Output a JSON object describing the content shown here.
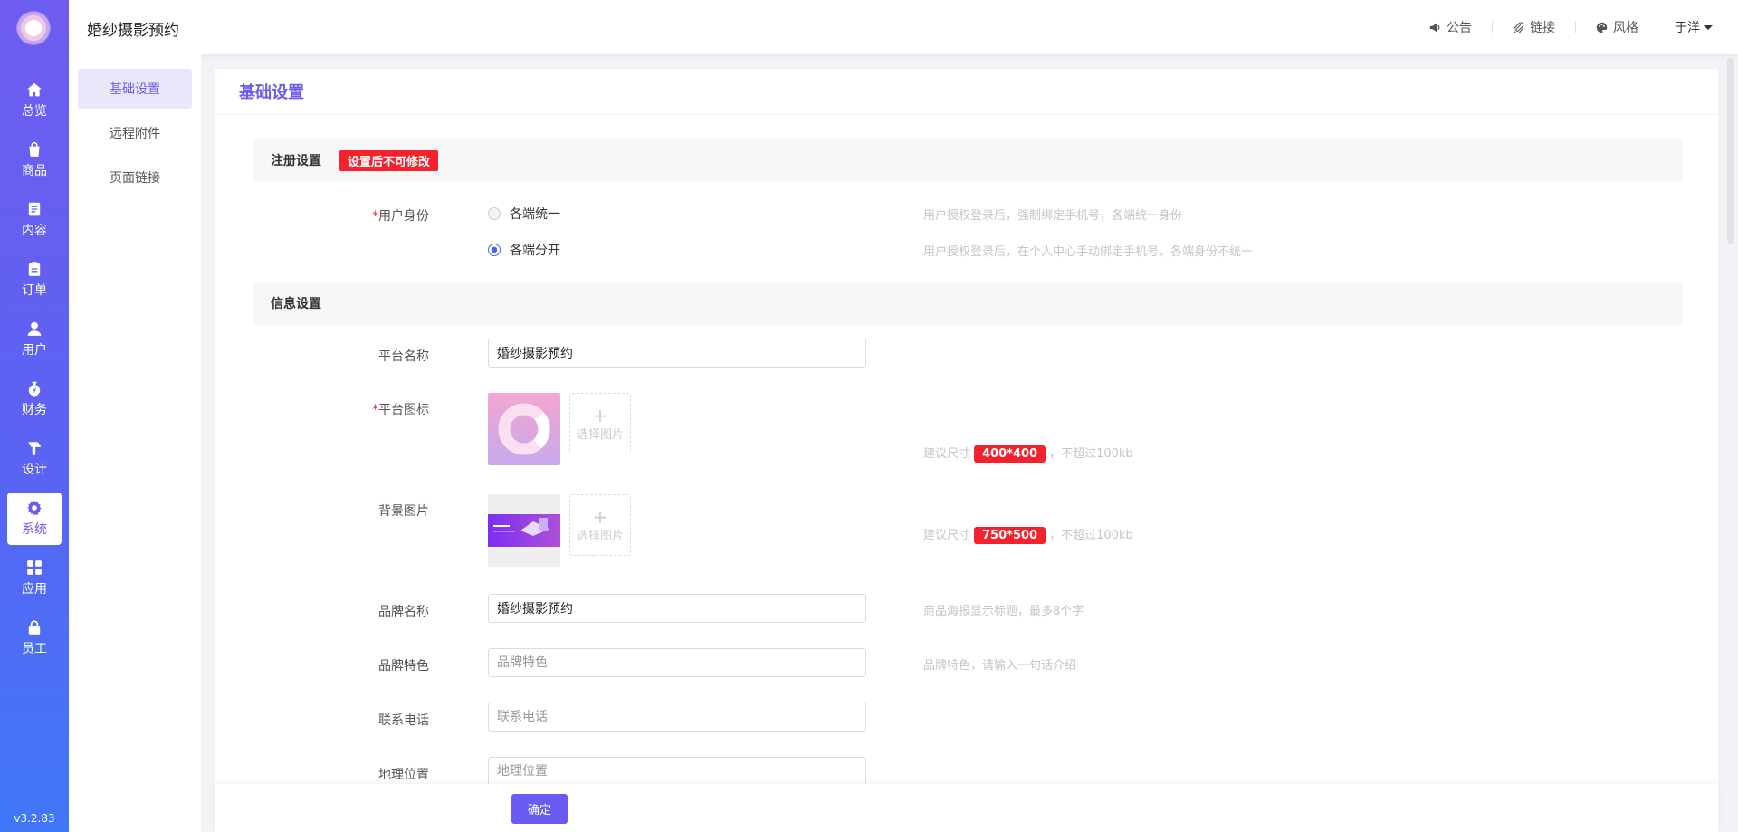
{
  "app": {
    "title": "婚纱摄影预约",
    "version": "v3.2.83"
  },
  "rail": {
    "items": [
      {
        "label": "总览",
        "icon": "home-icon"
      },
      {
        "label": "商品",
        "icon": "bag-icon"
      },
      {
        "label": "内容",
        "icon": "document-icon"
      },
      {
        "label": "订单",
        "icon": "clipboard-icon"
      },
      {
        "label": "用户",
        "icon": "user-icon"
      },
      {
        "label": "财务",
        "icon": "money-bag-icon"
      },
      {
        "label": "设计",
        "icon": "brush-icon"
      },
      {
        "label": "系统",
        "icon": "gear-icon"
      },
      {
        "label": "应用",
        "icon": "grid-icon"
      },
      {
        "label": "员工",
        "icon": "lock-icon"
      }
    ],
    "active": "系统"
  },
  "header": {
    "tools": [
      {
        "label": "公告",
        "icon": "megaphone-icon"
      },
      {
        "label": "链接",
        "icon": "paperclip-icon"
      },
      {
        "label": "风格",
        "icon": "palette-icon"
      }
    ],
    "user": "于洋"
  },
  "subnav": {
    "items": [
      "基础设置",
      "远程附件",
      "页面链接"
    ],
    "active": "基础设置"
  },
  "panel": {
    "title": "基础设置"
  },
  "register": {
    "section": "注册设置",
    "warning": "设置后不可修改",
    "label": "用户身份",
    "options": [
      {
        "label": "各端统一",
        "hint": "用户授权登录后，强制绑定手机号，各端统一身份",
        "checked": false
      },
      {
        "label": "各端分开",
        "hint": "用户授权登录后，在个人中心手动绑定手机号，各端身份不统一",
        "checked": true
      }
    ]
  },
  "info": {
    "section": "信息设置",
    "platform_name": {
      "label": "平台名称",
      "value": "婚纱摄影预约"
    },
    "platform_icon": {
      "label": "平台图标",
      "upload": "选择图片",
      "hint_pre": "建议尺寸",
      "size": "400*400",
      "hint_post": "，不超过100kb"
    },
    "background": {
      "label": "背景图片",
      "upload": "选择图片",
      "hint_pre": "建议尺寸",
      "size": "750*500",
      "hint_post": "，不超过100kb"
    },
    "brand_name": {
      "label": "品牌名称",
      "value": "婚纱摄影预约",
      "hint": "商品海报显示标题，最多8个字"
    },
    "brand_feature": {
      "label": "品牌特色",
      "placeholder": "品牌特色",
      "hint": "品牌特色，请输入一句话介绍"
    },
    "phone": {
      "label": "联系电话",
      "placeholder": "联系电话"
    },
    "location": {
      "label": "地理位置",
      "placeholder": "地理位置"
    }
  },
  "footer": {
    "confirm": "确定"
  },
  "colors": {
    "accent": "#6a5cf2",
    "danger": "#f5222d",
    "radio": "#4a62f6"
  }
}
